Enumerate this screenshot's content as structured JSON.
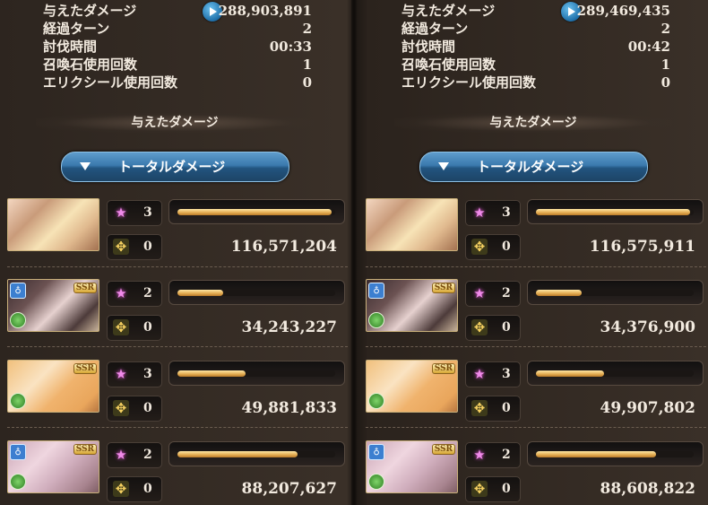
{
  "panels": [
    {
      "stats": {
        "damage_label": "与えたダメージ",
        "damage_value": "288,903,891",
        "turns_label": "経過ターン",
        "turns_value": "2",
        "time_label": "討伐時間",
        "time_value": "00:33",
        "summon_label": "召喚石使用回数",
        "summon_value": "1",
        "elixir_label": "エリクシール使用回数",
        "elixir_value": "0"
      },
      "section_title": "与えたダメージ",
      "dropdown_label": "トータルダメージ",
      "characters": [
        {
          "name": "main-character-pair",
          "stars": "3",
          "ca": "0",
          "damage": "116,571,204",
          "bar_fraction": 0.98
        },
        {
          "name": "character-2",
          "stars": "2",
          "ca": "0",
          "damage": "34,243,227",
          "bar_fraction": 0.29
        },
        {
          "name": "character-3",
          "stars": "3",
          "ca": "0",
          "damage": "49,881,833",
          "bar_fraction": 0.43
        },
        {
          "name": "character-4",
          "stars": "2",
          "ca": "0",
          "damage": "88,207,627",
          "bar_fraction": 0.76
        }
      ]
    },
    {
      "stats": {
        "damage_label": "与えたダメージ",
        "damage_value": "289,469,435",
        "turns_label": "経過ターン",
        "turns_value": "2",
        "time_label": "討伐時間",
        "time_value": "00:42",
        "summon_label": "召喚石使用回数",
        "summon_value": "1",
        "elixir_label": "エリクシール使用回数",
        "elixir_value": "0"
      },
      "section_title": "与えたダメージ",
      "dropdown_label": "トータルダメージ",
      "characters": [
        {
          "name": "main-character-pair",
          "stars": "3",
          "ca": "0",
          "damage": "116,575,911",
          "bar_fraction": 0.98
        },
        {
          "name": "character-2",
          "stars": "2",
          "ca": "0",
          "damage": "34,376,900",
          "bar_fraction": 0.29
        },
        {
          "name": "character-3",
          "stars": "3",
          "ca": "0",
          "damage": "49,907,802",
          "bar_fraction": 0.43
        },
        {
          "name": "character-4",
          "stars": "2",
          "ca": "0",
          "damage": "88,608,822",
          "bar_fraction": 0.76
        }
      ]
    }
  ],
  "badges": {
    "ssr": "SSR",
    "class": "♁"
  },
  "icons": {
    "play": "play-icon",
    "star": "★",
    "ca": "✥"
  }
}
